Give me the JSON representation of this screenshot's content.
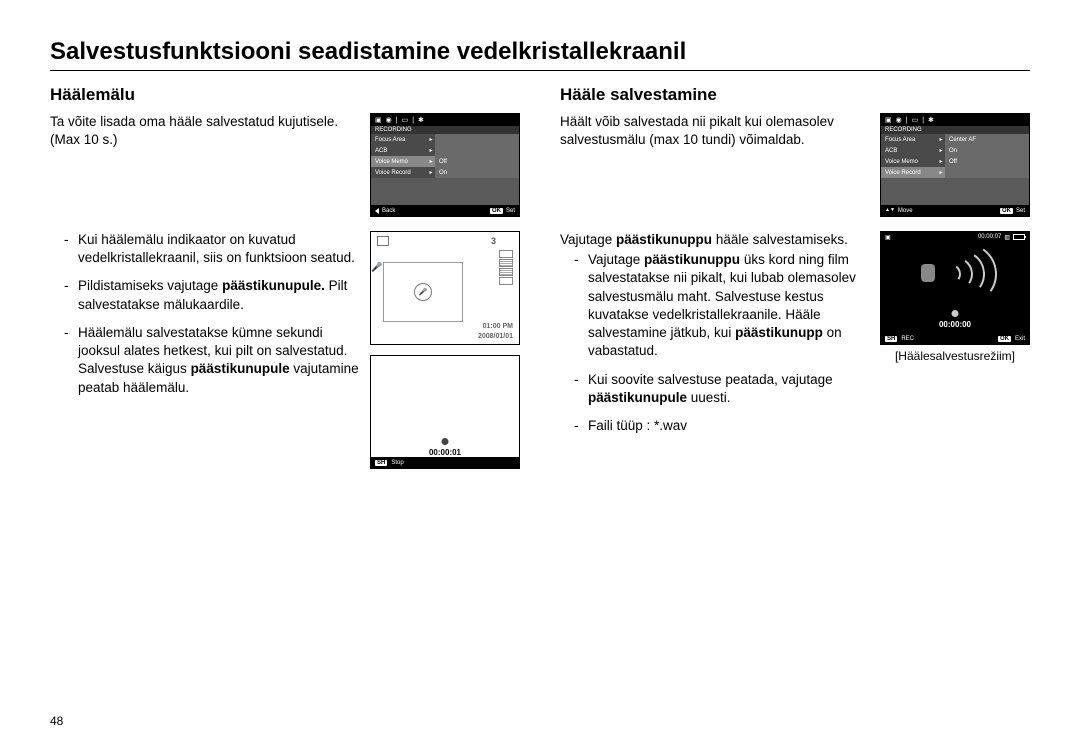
{
  "page": {
    "title": "Salvestusfunktsiooni seadistamine vedelkristallekraanil",
    "number": "48"
  },
  "left": {
    "heading": "Häälemälu",
    "intro": "Ta võite lisada oma hääle salvestatud kujutisele. (Max 10 s.)",
    "bullets": [
      "Kui häälemälu indikaator on kuvatud vedelkristallekraanil, siis on funktsioon seatud.",
      "Pildistamiseks vajutage <b>päästikunupule.</b> Pilt salvestatakse mälukaardile.",
      "Häälemälu salvestatakse kümne sekundi jooksul alates hetkest, kui pilt on salvestatud. Salvestuse käigus <b>päästikunupule</b> vajutamine peatab häälemälu."
    ],
    "lcd_menu": {
      "title": "RECORDING",
      "rows": [
        {
          "label": "Focus Area",
          "value": ""
        },
        {
          "label": "ACB",
          "value": ""
        },
        {
          "label": "Voice Memo",
          "value": "Off",
          "hl": true
        },
        {
          "label": "Voice Record",
          "value": "On"
        }
      ],
      "foot_left_icon": "◀",
      "foot_left": "Back",
      "foot_right_icon": "OK",
      "foot_right": "Set"
    },
    "lcd_preview": {
      "count": "3",
      "time": "01:00 PM",
      "date": "2008/01/01"
    },
    "lcd_rec": {
      "timer": "00:00:01",
      "foot_icon": "SH",
      "foot": "Stop"
    }
  },
  "right": {
    "heading": "Hääle salvestamine",
    "intro": "Häält võib salvestada nii pikalt kui olemasolev salvestusmälu (max 10 tundi) võimaldab.",
    "lead": "Vajutage <b>päästikunuppu</b> hääle salvestamiseks.",
    "bullets": [
      "Vajutage <b>päästikunuppu</b> üks kord ning film salvestatakse nii pikalt, kui lubab olemasolev salvestusmälu maht. Salvestuse kestus kuvatakse vedelkristallekraanile. Hääle salvestamine jätkub, kui <b>päästikunupp</b> on vabastatud.",
      "Kui soovite salvestuse peatada, vajutage <b>päästikunupule</b> uuesti.",
      "Faili tüüp : *.wav"
    ],
    "lcd_menu": {
      "title": "RECORDING",
      "rows": [
        {
          "label": "Focus Area",
          "value": "Center AF"
        },
        {
          "label": "ACB",
          "value": "On"
        },
        {
          "label": "Voice Memo",
          "value": "Off"
        },
        {
          "label": "Voice Record",
          "value": "",
          "hl": true
        }
      ],
      "foot_left_icon": "↕",
      "foot_left": "Move",
      "foot_right_icon": "OK",
      "foot_right": "Set"
    },
    "lcd_voice": {
      "top_time": "00:00:07",
      "timer": "00:00:00",
      "foot": {
        "sh": "SH",
        "rec": "REC",
        "ok": "OK",
        "exit": "Exit"
      }
    },
    "caption": "[Häälesalvestusrežiim]"
  }
}
